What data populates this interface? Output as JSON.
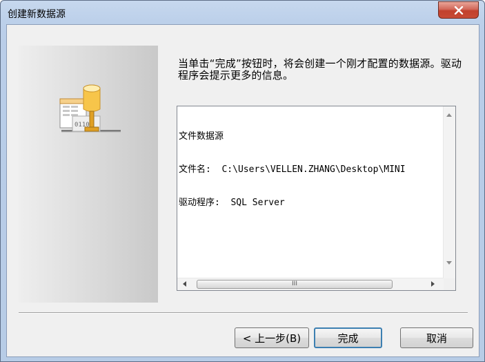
{
  "window": {
    "title": "创建新数据源",
    "close_label": "x"
  },
  "icons": {
    "close": "close-icon",
    "data_source": "database-network-icon",
    "scroll_up": "arrow-up-icon",
    "scroll_down": "arrow-down-icon",
    "scroll_left": "arrow-left-icon",
    "scroll_right": "arrow-right-icon"
  },
  "description": "当单击“完成”按钮时，将会创建一个刚才配置的数据源。驱动程序会提示更多的信息。",
  "summary": {
    "lines": [
      "文件数据源",
      "文件名:  C:\\Users\\VELLEN.ZHANG\\Desktop\\MINI",
      "驱动程序:  SQL Server"
    ],
    "hscroll_grip": "III"
  },
  "buttons": {
    "back": "< 上一步(B)",
    "finish": "完成",
    "cancel": "取消"
  },
  "colors": {
    "titlebar": "#bcd0ea",
    "close_button": "#c84a35",
    "dialog_background": "#f0f0f0",
    "default_button_border": "#3c7fb1"
  }
}
